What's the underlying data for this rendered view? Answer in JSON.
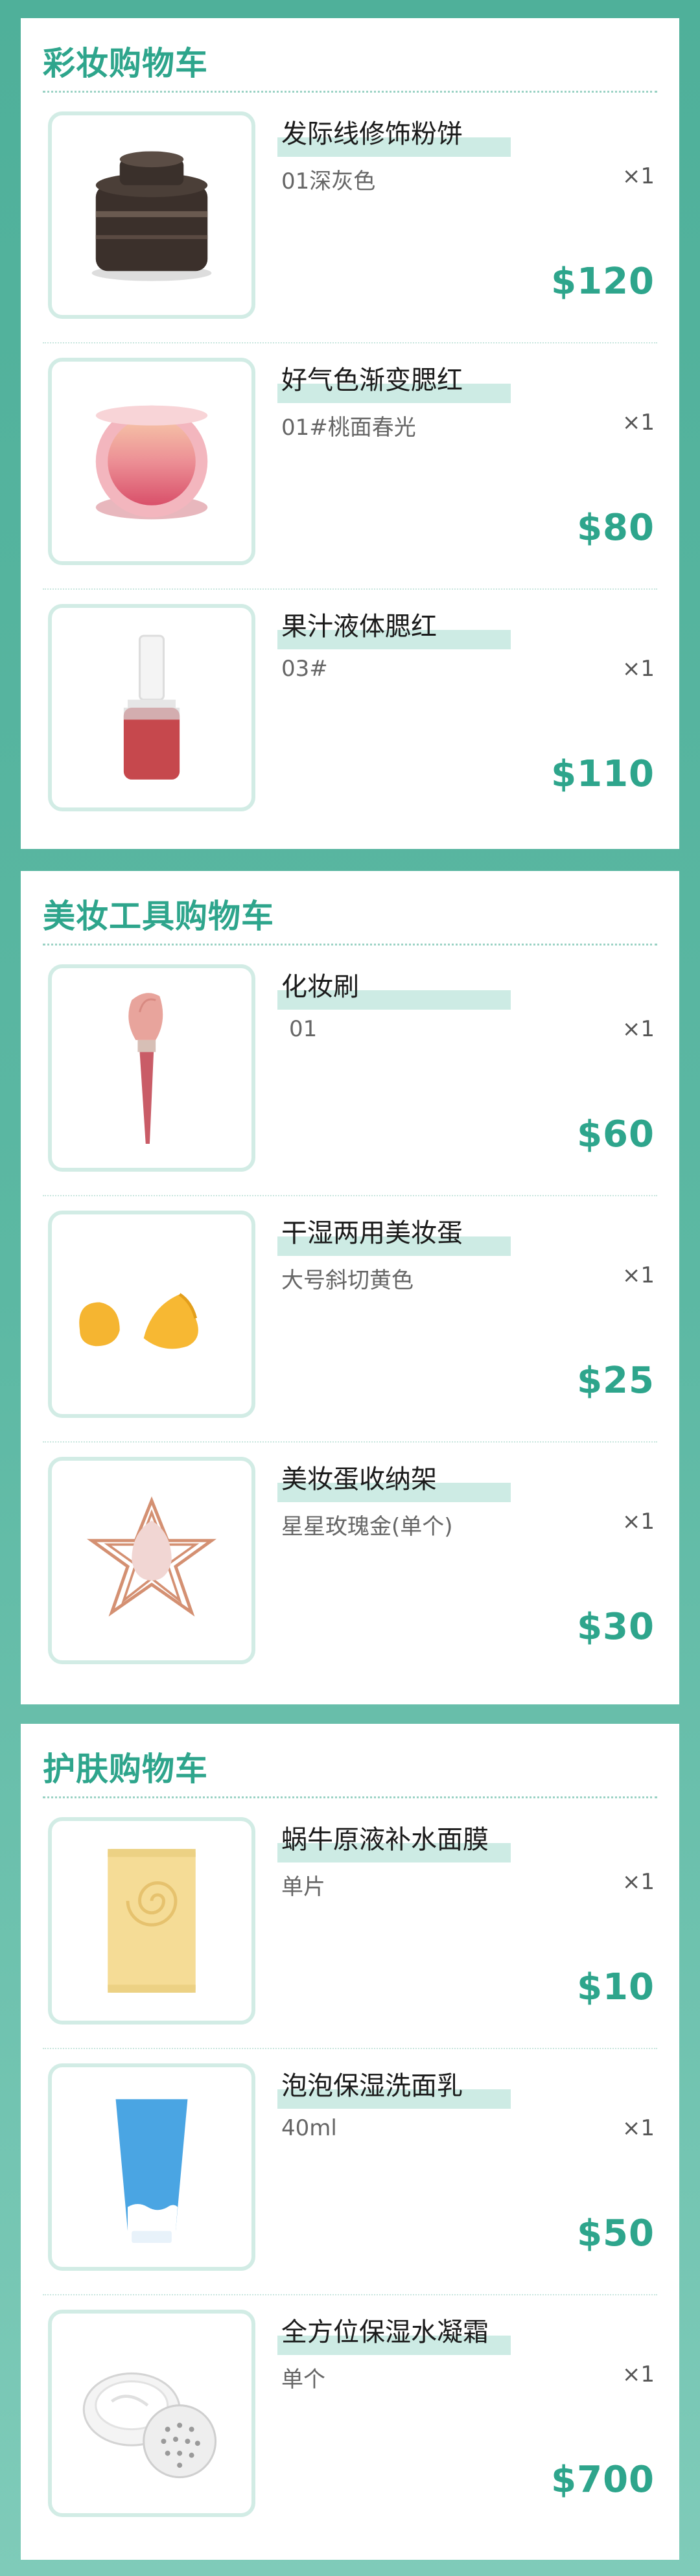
{
  "sections": [
    {
      "title": "彩妆购物车",
      "items": [
        {
          "name": "发际线修饰粉饼",
          "variant": "01深灰色",
          "qty": "×1",
          "price": "$120",
          "icon": "powder-compact-icon"
        },
        {
          "name": "好气色渐变腮红",
          "variant": "01#桃面春光",
          "qty": "×1",
          "price": "$80",
          "icon": "blush-compact-icon"
        },
        {
          "name": "果汁液体腮红",
          "variant": "03#",
          "qty": "×1",
          "price": "$110",
          "icon": "liquid-blush-icon"
        }
      ]
    },
    {
      "title": "美妆工具购物车",
      "items": [
        {
          "name": "化妆刷",
          "variant": "01",
          "qty": "×1",
          "price": "$60",
          "icon": "makeup-brush-icon"
        },
        {
          "name": "干湿两用美妆蛋",
          "variant": "大号斜切黄色",
          "qty": "×1",
          "price": "$25",
          "icon": "makeup-sponge-icon"
        },
        {
          "name": "美妆蛋收纳架",
          "variant": "星星玫瑰金(单个)",
          "qty": "×1",
          "price": "$30",
          "icon": "sponge-holder-icon"
        }
      ]
    },
    {
      "title": "护肤购物车",
      "items": [
        {
          "name": "蜗牛原液补水面膜",
          "variant": "单片",
          "qty": "×1",
          "price": "$10",
          "icon": "face-mask-icon"
        },
        {
          "name": "泡泡保湿洗面乳",
          "variant": "40ml",
          "qty": "×1",
          "price": "$50",
          "icon": "cleanser-tube-icon"
        },
        {
          "name": "全方位保湿水凝霜",
          "variant": "单个",
          "qty": "×1",
          "price": "$700",
          "icon": "cream-jar-icon"
        }
      ]
    }
  ],
  "colors": {
    "accent": "#2ea58c",
    "background": "#56b39e",
    "thumb_border": "#d2ece5",
    "name_highlight": "#cdebe4"
  }
}
